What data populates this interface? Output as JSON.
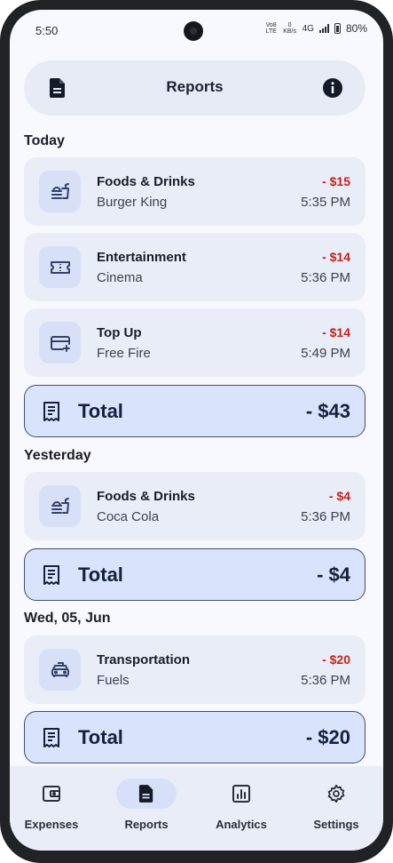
{
  "status_bar": {
    "time": "5:50",
    "volte": "Vo8 LTE",
    "speed": "0 KB/s",
    "network": "4G",
    "battery": "80%"
  },
  "header": {
    "title": "Reports",
    "left_icon": "document-icon",
    "right_icon": "info-icon"
  },
  "sections": [
    {
      "title": "Today",
      "transactions": [
        {
          "category": "Foods & Drinks",
          "merchant": "Burger King",
          "amount": "- $15",
          "time": "5:35 PM",
          "icon": "fastfood-icon"
        },
        {
          "category": "Entertainment",
          "merchant": "Cinema",
          "amount": "- $14",
          "time": "5:36 PM",
          "icon": "ticket-icon"
        },
        {
          "category": "Top Up",
          "merchant": "Free Fire",
          "amount": "- $14",
          "time": "5:49 PM",
          "icon": "card-add-icon"
        }
      ],
      "total_label": "Total",
      "total_value": "- $43"
    },
    {
      "title": "Yesterday",
      "transactions": [
        {
          "category": "Foods & Drinks",
          "merchant": "Coca Cola",
          "amount": "- $4",
          "time": "5:36 PM",
          "icon": "fastfood-icon"
        }
      ],
      "total_label": "Total",
      "total_value": "- $4"
    },
    {
      "title": "Wed, 05, Jun",
      "transactions": [
        {
          "category": "Transportation",
          "merchant": "Fuels",
          "amount": "- $20",
          "time": "5:36 PM",
          "icon": "taxi-icon"
        }
      ],
      "total_label": "Total",
      "total_value": "- $20"
    }
  ],
  "bottom_nav": [
    {
      "label": "Expenses",
      "icon": "wallet-icon",
      "active": false
    },
    {
      "label": "Reports",
      "icon": "document-icon",
      "active": true
    },
    {
      "label": "Analytics",
      "icon": "analytics-icon",
      "active": false
    },
    {
      "label": "Settings",
      "icon": "gear-icon",
      "active": false
    }
  ],
  "colors": {
    "negative_amount": "#c8201c",
    "total_bg": "#d9e3fb",
    "card_bg": "#e8edf7"
  }
}
